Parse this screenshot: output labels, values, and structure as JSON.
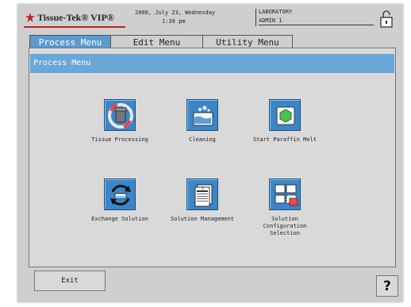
{
  "header": {
    "logo_text": "Tissue-Tek® VIP®",
    "date": "2008, July 23, Wednesday",
    "time": "1:39 pm",
    "location": "LABORATORY",
    "user": "ADMIN 1"
  },
  "tabs": [
    {
      "label": "Process Menu",
      "active": true
    },
    {
      "label": "Edit Menu",
      "active": false
    },
    {
      "label": "Utility Menu",
      "active": false
    }
  ],
  "panel": {
    "title": "Process Menu",
    "tiles": [
      {
        "label": "Tissue Processing",
        "icon": "tissue-processing-icon"
      },
      {
        "label": "Cleaning",
        "icon": "cleaning-icon"
      },
      {
        "label": "Start Paraffin Melt",
        "icon": "paraffin-melt-icon"
      },
      {
        "label": "Exchange Solution",
        "icon": "exchange-solution-icon"
      },
      {
        "label": "Solution Management",
        "icon": "solution-management-icon"
      },
      {
        "label": "Solution\nConfiguration\nSelection",
        "icon": "solution-configuration-icon"
      }
    ]
  },
  "footer": {
    "exit_label": "Exit",
    "help_label": "?"
  },
  "colors": {
    "accent_blue": "#6aa6d6",
    "tab_active": "#5b9bd1",
    "icon_blue": "#3a86c8",
    "logo_red": "#c62020"
  }
}
